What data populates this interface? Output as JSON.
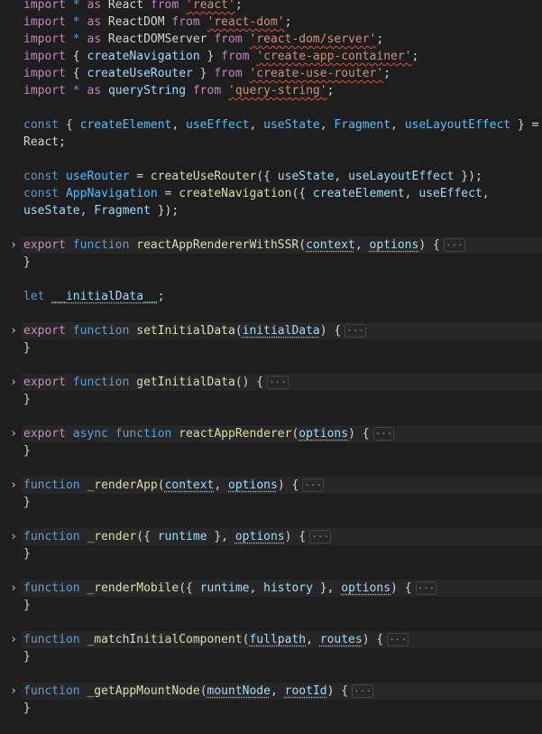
{
  "theme": {
    "background": "#1e1e1e",
    "keyword": "#569cd6",
    "control_keyword": "#c586c0",
    "function": "#dcdcaa",
    "variable": "#9cdcfe",
    "constant": "#4fc1ff",
    "type": "#4ec9b0",
    "string": "#ce9178",
    "punctuation": "#d4d4d4"
  },
  "fold_icon": "chevron-right-icon",
  "folded_marker": "···",
  "lines": [
    {
      "tokens": [
        {
          "c": "ck",
          "t": "import"
        },
        {
          "c": "p",
          "t": " "
        },
        {
          "c": "kw",
          "t": "*"
        },
        {
          "c": "p",
          "t": " "
        },
        {
          "c": "ck",
          "t": "as"
        },
        {
          "c": "p",
          "t": " React "
        },
        {
          "c": "ck",
          "t": "from"
        },
        {
          "c": "p",
          "t": " "
        },
        {
          "c": "s",
          "t": "'react'"
        },
        {
          "c": "p",
          "t": ";"
        }
      ]
    },
    {
      "tokens": [
        {
          "c": "ck",
          "t": "import"
        },
        {
          "c": "p",
          "t": " "
        },
        {
          "c": "kw",
          "t": "*"
        },
        {
          "c": "p",
          "t": " "
        },
        {
          "c": "ck",
          "t": "as"
        },
        {
          "c": "p",
          "t": " ReactDOM "
        },
        {
          "c": "ck",
          "t": "from"
        },
        {
          "c": "p",
          "t": " "
        },
        {
          "c": "s",
          "t": "'react-dom'"
        },
        {
          "c": "p",
          "t": ";"
        }
      ]
    },
    {
      "tokens": [
        {
          "c": "ck",
          "t": "import"
        },
        {
          "c": "p",
          "t": " "
        },
        {
          "c": "kw",
          "t": "*"
        },
        {
          "c": "p",
          "t": " "
        },
        {
          "c": "ck",
          "t": "as"
        },
        {
          "c": "p",
          "t": " ReactDOMServer "
        },
        {
          "c": "ck",
          "t": "from"
        },
        {
          "c": "p",
          "t": " "
        },
        {
          "c": "s",
          "t": "'react-dom/server'"
        },
        {
          "c": "p",
          "t": ";"
        }
      ]
    },
    {
      "tokens": [
        {
          "c": "ck",
          "t": "import"
        },
        {
          "c": "p",
          "t": " { "
        },
        {
          "c": "v",
          "t": "createNavigation"
        },
        {
          "c": "p",
          "t": " } "
        },
        {
          "c": "ck",
          "t": "from"
        },
        {
          "c": "p",
          "t": " "
        },
        {
          "c": "s",
          "t": "'create-app-container'"
        },
        {
          "c": "p",
          "t": ";"
        }
      ]
    },
    {
      "tokens": [
        {
          "c": "ck",
          "t": "import"
        },
        {
          "c": "p",
          "t": " { "
        },
        {
          "c": "v",
          "t": "createUseRouter"
        },
        {
          "c": "p",
          "t": " } "
        },
        {
          "c": "ck",
          "t": "from"
        },
        {
          "c": "p",
          "t": " "
        },
        {
          "c": "s",
          "t": "'create-use-router'"
        },
        {
          "c": "p",
          "t": ";"
        }
      ]
    },
    {
      "tokens": [
        {
          "c": "ck",
          "t": "import"
        },
        {
          "c": "p",
          "t": " "
        },
        {
          "c": "kw",
          "t": "*"
        },
        {
          "c": "p",
          "t": " "
        },
        {
          "c": "ck",
          "t": "as"
        },
        {
          "c": "p",
          "t": " "
        },
        {
          "c": "v",
          "t": "queryString"
        },
        {
          "c": "p",
          "t": " "
        },
        {
          "c": "ck",
          "t": "from"
        },
        {
          "c": "p",
          "t": " "
        },
        {
          "c": "s",
          "t": "'query-string'"
        },
        {
          "c": "p",
          "t": ";"
        }
      ]
    },
    {
      "tokens": []
    },
    {
      "tokens": [
        {
          "c": "kw",
          "t": "const"
        },
        {
          "c": "p",
          "t": " { "
        },
        {
          "c": "cn",
          "t": "createElement"
        },
        {
          "c": "p",
          "t": ", "
        },
        {
          "c": "cn",
          "t": "useEffect"
        },
        {
          "c": "p",
          "t": ", "
        },
        {
          "c": "cn",
          "t": "useState"
        },
        {
          "c": "p",
          "t": ", "
        },
        {
          "c": "cn",
          "t": "Fragment"
        },
        {
          "c": "p",
          "t": ", "
        },
        {
          "c": "cn",
          "t": "useLayoutEffect"
        },
        {
          "c": "p",
          "t": " } ="
        }
      ]
    },
    {
      "tokens": [
        {
          "c": "p",
          "t": "React;"
        }
      ]
    },
    {
      "tokens": []
    },
    {
      "tokens": [
        {
          "c": "kw",
          "t": "const"
        },
        {
          "c": "p",
          "t": " "
        },
        {
          "c": "cn",
          "t": "useRouter"
        },
        {
          "c": "p",
          "t": " = "
        },
        {
          "c": "fn",
          "t": "createUseRouter"
        },
        {
          "c": "p",
          "t": "({ "
        },
        {
          "c": "v",
          "t": "useState"
        },
        {
          "c": "p",
          "t": ", "
        },
        {
          "c": "v",
          "t": "useLayoutEffect"
        },
        {
          "c": "p",
          "t": " });"
        }
      ]
    },
    {
      "tokens": [
        {
          "c": "kw",
          "t": "const"
        },
        {
          "c": "p",
          "t": " "
        },
        {
          "c": "cn",
          "t": "AppNavigation"
        },
        {
          "c": "p",
          "t": " = "
        },
        {
          "c": "fn",
          "t": "createNavigation"
        },
        {
          "c": "p",
          "t": "({ "
        },
        {
          "c": "v",
          "t": "createElement"
        },
        {
          "c": "p",
          "t": ", "
        },
        {
          "c": "v",
          "t": "useEffect"
        },
        {
          "c": "p",
          "t": ","
        }
      ]
    },
    {
      "tokens": [
        {
          "c": "v",
          "t": "useState"
        },
        {
          "c": "p",
          "t": ", "
        },
        {
          "c": "v",
          "t": "Fragment"
        },
        {
          "c": "p",
          "t": " });"
        }
      ]
    },
    {
      "tokens": []
    },
    {
      "fold": true,
      "tokens": [
        {
          "c": "ck",
          "t": "export"
        },
        {
          "c": "p",
          "t": " "
        },
        {
          "c": "kw",
          "t": "function"
        },
        {
          "c": "p",
          "t": " "
        },
        {
          "c": "fn",
          "t": "reactAppRendererWithSSR"
        },
        {
          "c": "p",
          "t": "("
        },
        {
          "c": "vh",
          "t": "context"
        },
        {
          "c": "p",
          "t": ", "
        },
        {
          "c": "vh",
          "t": "options"
        },
        {
          "c": "p",
          "t": ") {"
        }
      ]
    },
    {
      "tokens": [
        {
          "c": "p",
          "t": "}"
        }
      ]
    },
    {
      "tokens": []
    },
    {
      "tokens": [
        {
          "c": "kw",
          "t": "let"
        },
        {
          "c": "p",
          "t": " "
        },
        {
          "c": "vh",
          "t": "__initialData__"
        },
        {
          "c": "p",
          "t": ";"
        }
      ]
    },
    {
      "tokens": []
    },
    {
      "fold": true,
      "tokens": [
        {
          "c": "ck",
          "t": "export"
        },
        {
          "c": "p",
          "t": " "
        },
        {
          "c": "kw",
          "t": "function"
        },
        {
          "c": "p",
          "t": " "
        },
        {
          "c": "fn",
          "t": "setInitialData"
        },
        {
          "c": "p",
          "t": "("
        },
        {
          "c": "vh",
          "t": "initialData"
        },
        {
          "c": "p",
          "t": ") {"
        }
      ]
    },
    {
      "tokens": [
        {
          "c": "p",
          "t": "}"
        }
      ]
    },
    {
      "tokens": []
    },
    {
      "fold": true,
      "tokens": [
        {
          "c": "ck",
          "t": "export"
        },
        {
          "c": "p",
          "t": " "
        },
        {
          "c": "kw",
          "t": "function"
        },
        {
          "c": "p",
          "t": " "
        },
        {
          "c": "fn",
          "t": "getInitialData"
        },
        {
          "c": "p",
          "t": "() {"
        }
      ]
    },
    {
      "tokens": [
        {
          "c": "p",
          "t": "}"
        }
      ]
    },
    {
      "tokens": []
    },
    {
      "fold": true,
      "tokens": [
        {
          "c": "ck",
          "t": "export"
        },
        {
          "c": "p",
          "t": " "
        },
        {
          "c": "kw",
          "t": "async"
        },
        {
          "c": "p",
          "t": " "
        },
        {
          "c": "kw",
          "t": "function"
        },
        {
          "c": "p",
          "t": " "
        },
        {
          "c": "fn",
          "t": "reactAppRenderer"
        },
        {
          "c": "p",
          "t": "("
        },
        {
          "c": "vh",
          "t": "options"
        },
        {
          "c": "p",
          "t": ") {"
        }
      ]
    },
    {
      "tokens": [
        {
          "c": "p",
          "t": "}"
        }
      ]
    },
    {
      "tokens": []
    },
    {
      "fold": true,
      "tokens": [
        {
          "c": "kw",
          "t": "function"
        },
        {
          "c": "p",
          "t": " "
        },
        {
          "c": "fn",
          "t": "_renderApp"
        },
        {
          "c": "p",
          "t": "("
        },
        {
          "c": "vh",
          "t": "context"
        },
        {
          "c": "p",
          "t": ", "
        },
        {
          "c": "vh",
          "t": "options"
        },
        {
          "c": "p",
          "t": ") {"
        }
      ]
    },
    {
      "tokens": [
        {
          "c": "p",
          "t": "}"
        }
      ]
    },
    {
      "tokens": []
    },
    {
      "fold": true,
      "tokens": [
        {
          "c": "kw",
          "t": "function"
        },
        {
          "c": "p",
          "t": " "
        },
        {
          "c": "fn",
          "t": "_render"
        },
        {
          "c": "p",
          "t": "({ "
        },
        {
          "c": "v",
          "t": "runtime"
        },
        {
          "c": "p",
          "t": " }, "
        },
        {
          "c": "vh",
          "t": "options"
        },
        {
          "c": "p",
          "t": ") {"
        }
      ]
    },
    {
      "tokens": [
        {
          "c": "p",
          "t": "}"
        }
      ]
    },
    {
      "tokens": []
    },
    {
      "fold": true,
      "tokens": [
        {
          "c": "kw",
          "t": "function"
        },
        {
          "c": "p",
          "t": " "
        },
        {
          "c": "fn",
          "t": "_renderMobile"
        },
        {
          "c": "p",
          "t": "({ "
        },
        {
          "c": "v",
          "t": "runtime"
        },
        {
          "c": "p",
          "t": ", "
        },
        {
          "c": "v",
          "t": "history"
        },
        {
          "c": "p",
          "t": " }, "
        },
        {
          "c": "vh",
          "t": "options"
        },
        {
          "c": "p",
          "t": ") {"
        }
      ]
    },
    {
      "tokens": [
        {
          "c": "p",
          "t": "}"
        }
      ]
    },
    {
      "tokens": []
    },
    {
      "fold": true,
      "tokens": [
        {
          "c": "kw",
          "t": "function"
        },
        {
          "c": "p",
          "t": " "
        },
        {
          "c": "fn",
          "t": "_matchInitialComponent"
        },
        {
          "c": "p",
          "t": "("
        },
        {
          "c": "vh",
          "t": "fullpath"
        },
        {
          "c": "p",
          "t": ", "
        },
        {
          "c": "vh",
          "t": "routes"
        },
        {
          "c": "p",
          "t": ") {"
        }
      ]
    },
    {
      "tokens": [
        {
          "c": "p",
          "t": "}"
        }
      ]
    },
    {
      "tokens": []
    },
    {
      "fold": true,
      "tokens": [
        {
          "c": "kw",
          "t": "function"
        },
        {
          "c": "p",
          "t": " "
        },
        {
          "c": "fn",
          "t": "_getAppMountNode"
        },
        {
          "c": "p",
          "t": "("
        },
        {
          "c": "vh",
          "t": "mountNode"
        },
        {
          "c": "p",
          "t": ", "
        },
        {
          "c": "vh",
          "t": "rootId"
        },
        {
          "c": "p",
          "t": ") {"
        }
      ]
    },
    {
      "tokens": [
        {
          "c": "p",
          "t": "}"
        }
      ]
    }
  ]
}
